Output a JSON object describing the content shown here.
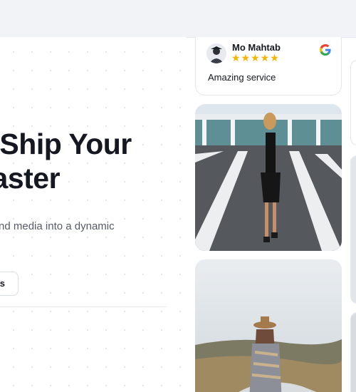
{
  "hero": {
    "headline_line1": "d Ship Your",
    "headline_line2": "Faster",
    "subtext": "views and media into a dynamic",
    "cta_label": "us"
  },
  "review": {
    "name": "Mo Mahtab",
    "rating": 5,
    "stars": "★★★★★",
    "text": "Amazing service",
    "source_icon": "google-icon"
  },
  "gallery": {
    "photo1": "woman-black-dress-crosswalk",
    "photo2": "person-hat-poncho-field"
  },
  "colors": {
    "star": "#f5b400",
    "text_dark": "#151821",
    "text_muted": "#555b66",
    "topbar": "#f1f3f7"
  }
}
